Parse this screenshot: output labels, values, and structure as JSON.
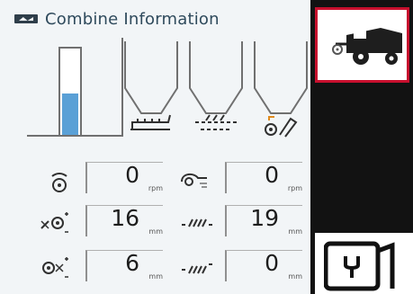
{
  "header": {
    "title": "Combine Information"
  },
  "tank": {
    "fill_fraction": 0.48
  },
  "readouts": [
    {
      "icon": "rotor-speed-icon",
      "value": "0",
      "unit": "rpm"
    },
    {
      "icon": "fan-speed-icon",
      "value": "0",
      "unit": "rpm"
    },
    {
      "icon": "concave-clearance-icon",
      "value": "16",
      "unit": "mm"
    },
    {
      "icon": "upper-sieve-icon",
      "value": "19",
      "unit": "mm"
    },
    {
      "icon": "chaffer-adjust-icon",
      "value": "6",
      "unit": "mm"
    },
    {
      "icon": "lower-sieve-icon",
      "value": "0",
      "unit": "mm"
    }
  ],
  "colors": {
    "accent": "#c8102e",
    "tank_fill": "#5aa0d6",
    "nav_bg": "#121212"
  }
}
